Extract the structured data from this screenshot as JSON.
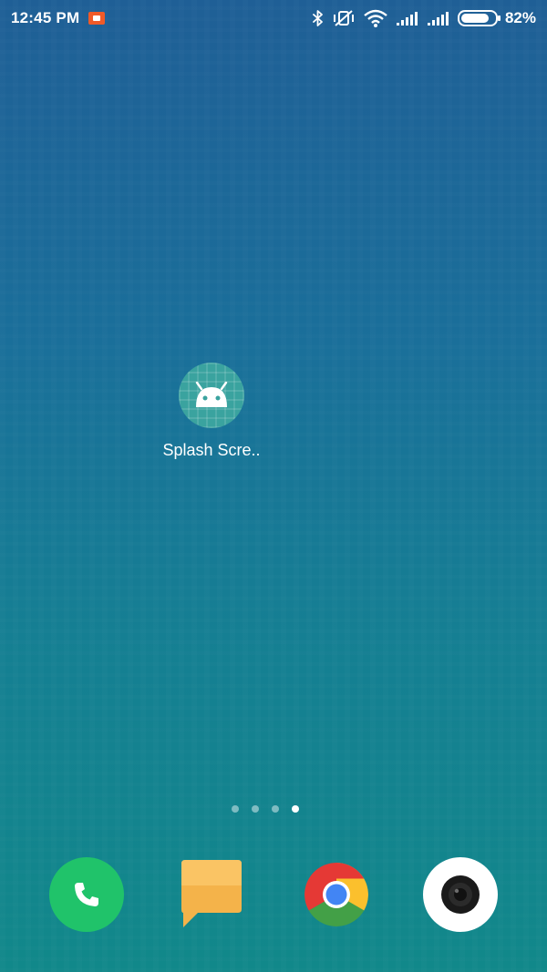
{
  "status_bar": {
    "time": "12:45 PM",
    "battery_percent": "82%",
    "battery_level": 0.82,
    "icons": [
      "screen-record-icon",
      "bluetooth-icon",
      "vibrate-off-icon",
      "wifi-icon",
      "signal-1-icon",
      "signal-2-icon",
      "battery-icon"
    ]
  },
  "home": {
    "app": {
      "label": "Splash Scre..",
      "icon": "android-app-icon"
    },
    "page_indicator": {
      "count": 4,
      "active_index": 3
    }
  },
  "dock": {
    "items": [
      {
        "name": "phone",
        "icon": "phone-icon"
      },
      {
        "name": "messages",
        "icon": "messages-icon"
      },
      {
        "name": "chrome",
        "icon": "chrome-icon"
      },
      {
        "name": "camera",
        "icon": "camera-icon"
      }
    ]
  },
  "colors": {
    "background_top": "#1f5f96",
    "background_bottom": "#11888a",
    "phone_green": "#20c36a",
    "messages_orange": "#f4b34a",
    "record_orange": "#f05a28"
  }
}
